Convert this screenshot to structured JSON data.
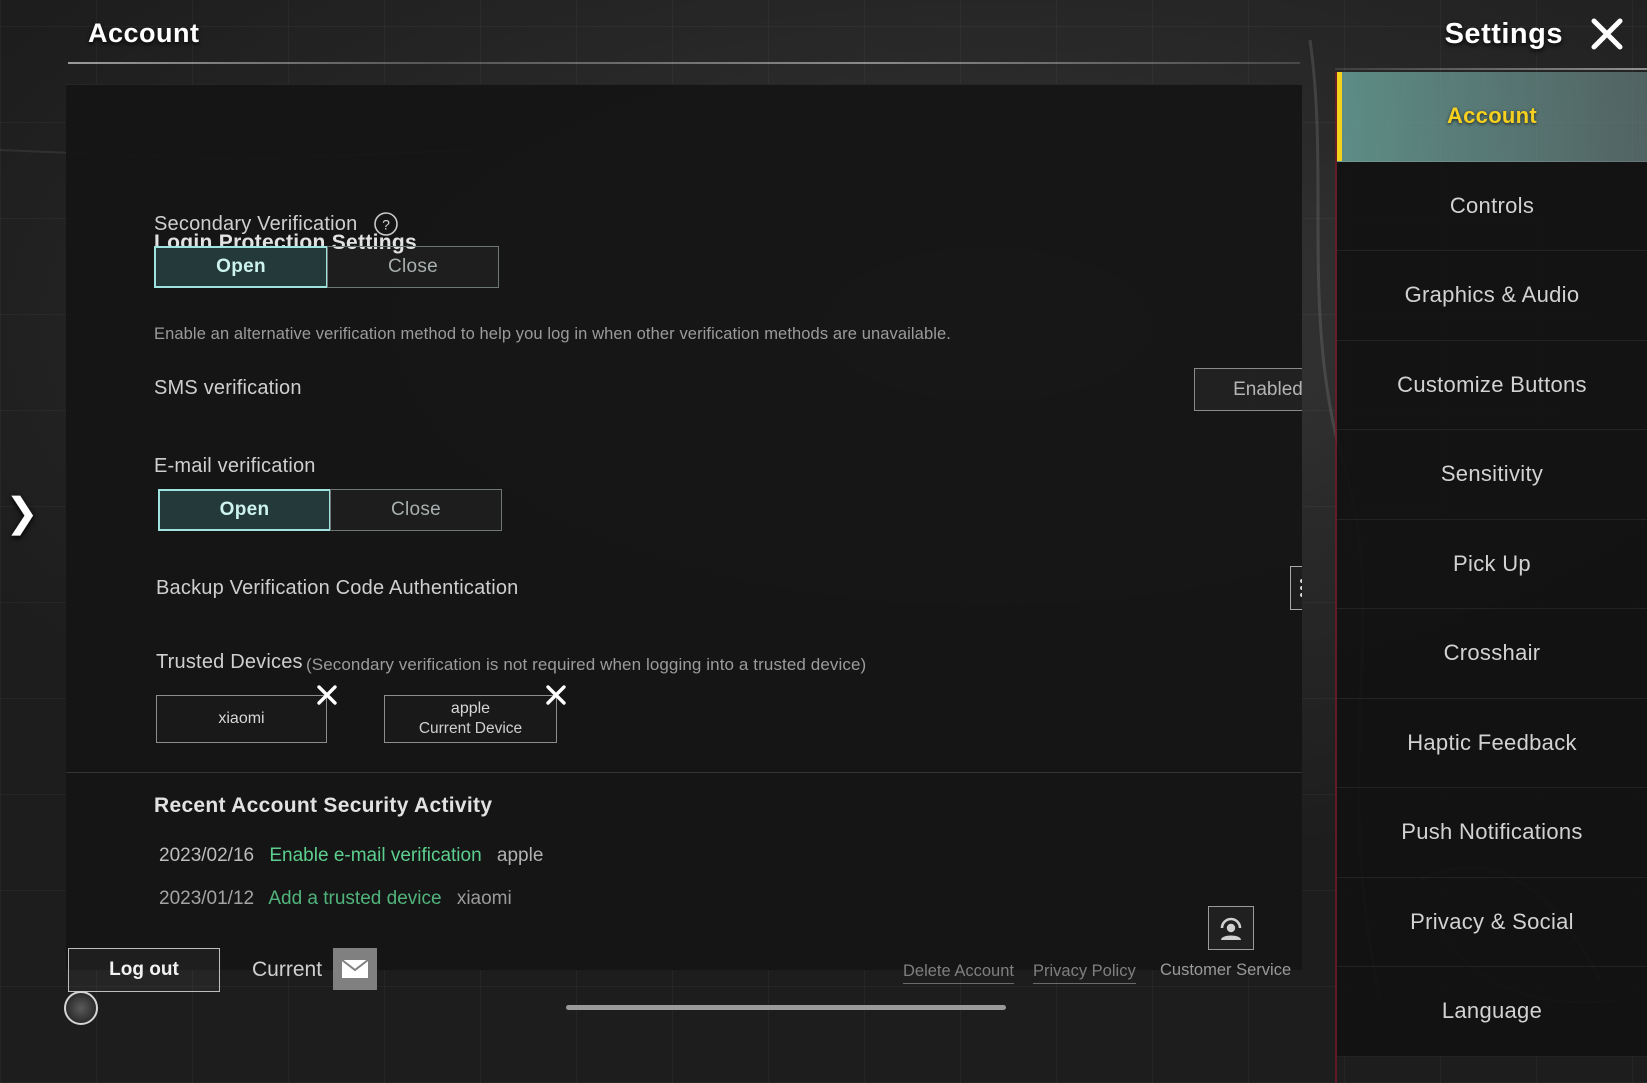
{
  "header": {
    "page_title": "Account",
    "settings_title": "Settings",
    "close_icon": "close-x-icon"
  },
  "login_protection": {
    "section_title": "Login Protection Settings",
    "secondary_verification": {
      "label": "Secondary Verification",
      "help_icon": "question-mark-icon",
      "options": [
        "Open",
        "Close"
      ],
      "selected": "Open"
    },
    "description": "Enable an alternative verification method to help you log in when other verification methods are unavailable.",
    "sms_verification": {
      "label": "SMS verification",
      "status_button": "Enabled"
    },
    "email_verification": {
      "label": "E-mail verification",
      "options": [
        "Open",
        "Close"
      ],
      "selected": "Open"
    },
    "backup_code": {
      "label": "Backup Verification Code Authentication",
      "icon": "list-icon"
    },
    "trusted_devices": {
      "label": "Trusted Devices",
      "note": "(Secondary verification is not required when logging into a trusted device)",
      "devices": [
        {
          "name": "xiaomi",
          "sub": "",
          "remove_icon": "close-x-icon"
        },
        {
          "name": "apple",
          "sub": "Current Device",
          "remove_icon": "close-x-icon"
        }
      ]
    }
  },
  "recent_activity": {
    "section_title": "Recent Account Security Activity",
    "entries": [
      {
        "date": "2023/02/16",
        "action": "Enable e-mail verification",
        "device": "apple"
      },
      {
        "date": "2023/01/12",
        "action": "Add a trusted device",
        "device": "xiaomi"
      }
    ]
  },
  "bottom_bar": {
    "logout_label": "Log out",
    "current_label": "Current",
    "mail_icon": "envelope-icon",
    "delete_account_label": "Delete Account",
    "privacy_policy_label": "Privacy Policy",
    "customer_service_label": "Customer Service",
    "customer_service_icon": "headset-agent-icon"
  },
  "left_arrow_icon": "chevron-right-icon",
  "sidebar": {
    "items": [
      {
        "label": "Account",
        "active": true
      },
      {
        "label": "Controls",
        "active": false
      },
      {
        "label": "Graphics & Audio",
        "active": false
      },
      {
        "label": "Customize Buttons",
        "active": false
      },
      {
        "label": "Sensitivity",
        "active": false
      },
      {
        "label": "Pick Up",
        "active": false
      },
      {
        "label": "Crosshair",
        "active": false
      },
      {
        "label": "Haptic Feedback",
        "active": false
      },
      {
        "label": "Push Notifications",
        "active": false
      },
      {
        "label": "Privacy & Social",
        "active": false
      },
      {
        "label": "Language",
        "active": false
      }
    ]
  },
  "colors": {
    "accent_yellow": "#f5d020",
    "accent_teal": "#9fe3de",
    "activity_green": "#5ccf8e",
    "sidebar_red_edge": "#781a26"
  }
}
